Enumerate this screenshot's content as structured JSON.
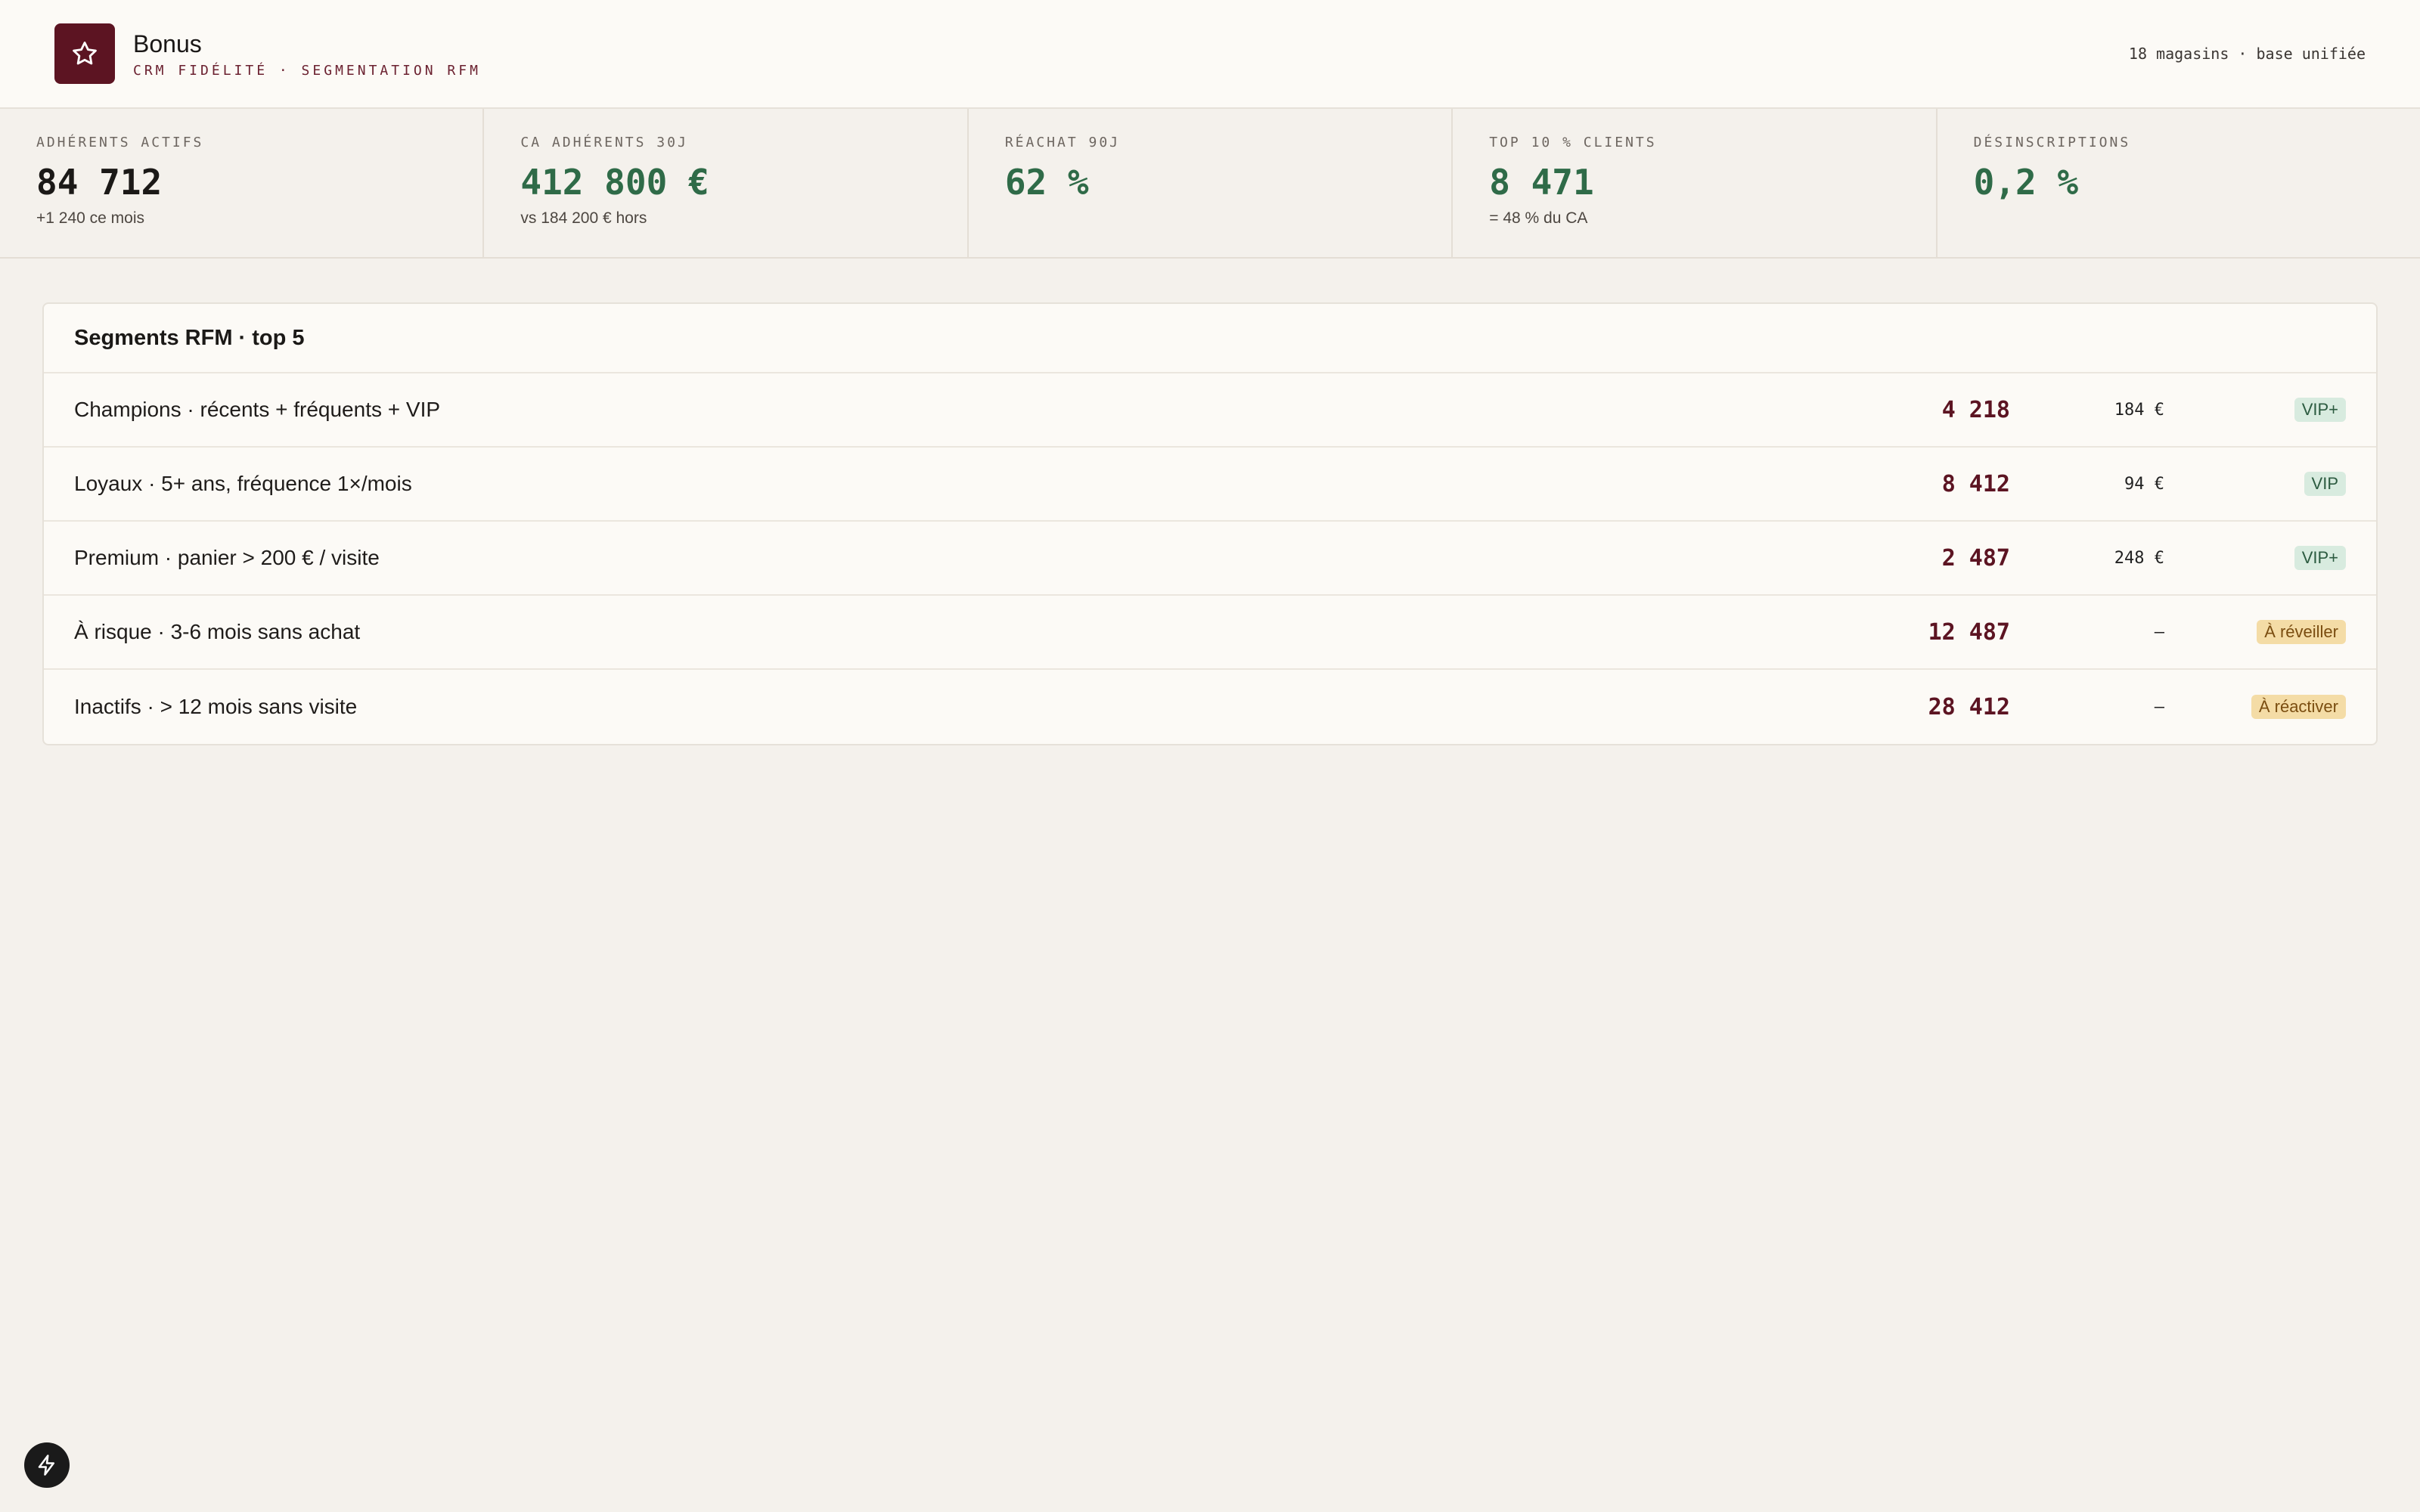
{
  "header": {
    "brand_name": "Bonus",
    "brand_subtitle": "CRM FIDÉLITÉ · SEGMENTATION RFM",
    "meta": "18 magasins · base unifiée",
    "logo_icon": "star-icon"
  },
  "kpis": [
    {
      "label": "ADHÉRENTS ACTIFS",
      "value": "84 712",
      "note": "+1 240 ce mois"
    },
    {
      "label": "CA ADHÉRENTS 30J",
      "value": "412 800 €",
      "note": "vs 184 200 € hors"
    },
    {
      "label": "RÉACHAT 90J",
      "value": "62 %",
      "note": ""
    },
    {
      "label": "TOP 10 % CLIENTS",
      "value": "8 471",
      "note": "= 48 % du CA"
    },
    {
      "label": "DÉSINSCRIPTIONS",
      "value": "0,2 %",
      "note": ""
    }
  ],
  "segments": {
    "title": "Segments RFM · top 5",
    "rows": [
      {
        "label": "Champions · récents + fréquents + VIP",
        "count": "4 218",
        "avg": "184 €",
        "tag": "VIP+"
      },
      {
        "label": "Loyaux · 5+ ans, fréquence 1×/mois",
        "count": "8 412",
        "avg": "94 €",
        "tag": "VIP"
      },
      {
        "label": "Premium · panier > 200 € / visite",
        "count": "2 487",
        "avg": "248 €",
        "tag": "VIP+"
      },
      {
        "label": "À risque · 3-6 mois sans achat",
        "count": "12 487",
        "avg": "–",
        "tag": "À réveiller"
      },
      {
        "label": "Inactifs · > 12 mois sans visite",
        "count": "28 412",
        "avg": "–",
        "tag": "À réactiver"
      }
    ]
  },
  "colors": {
    "brand": "#5c1422",
    "positive": "#2f6b48",
    "vip_tag_bg": "#d8ebdf",
    "warn_tag_bg": "#f4dca6"
  },
  "fab_icon": "lightning-icon"
}
